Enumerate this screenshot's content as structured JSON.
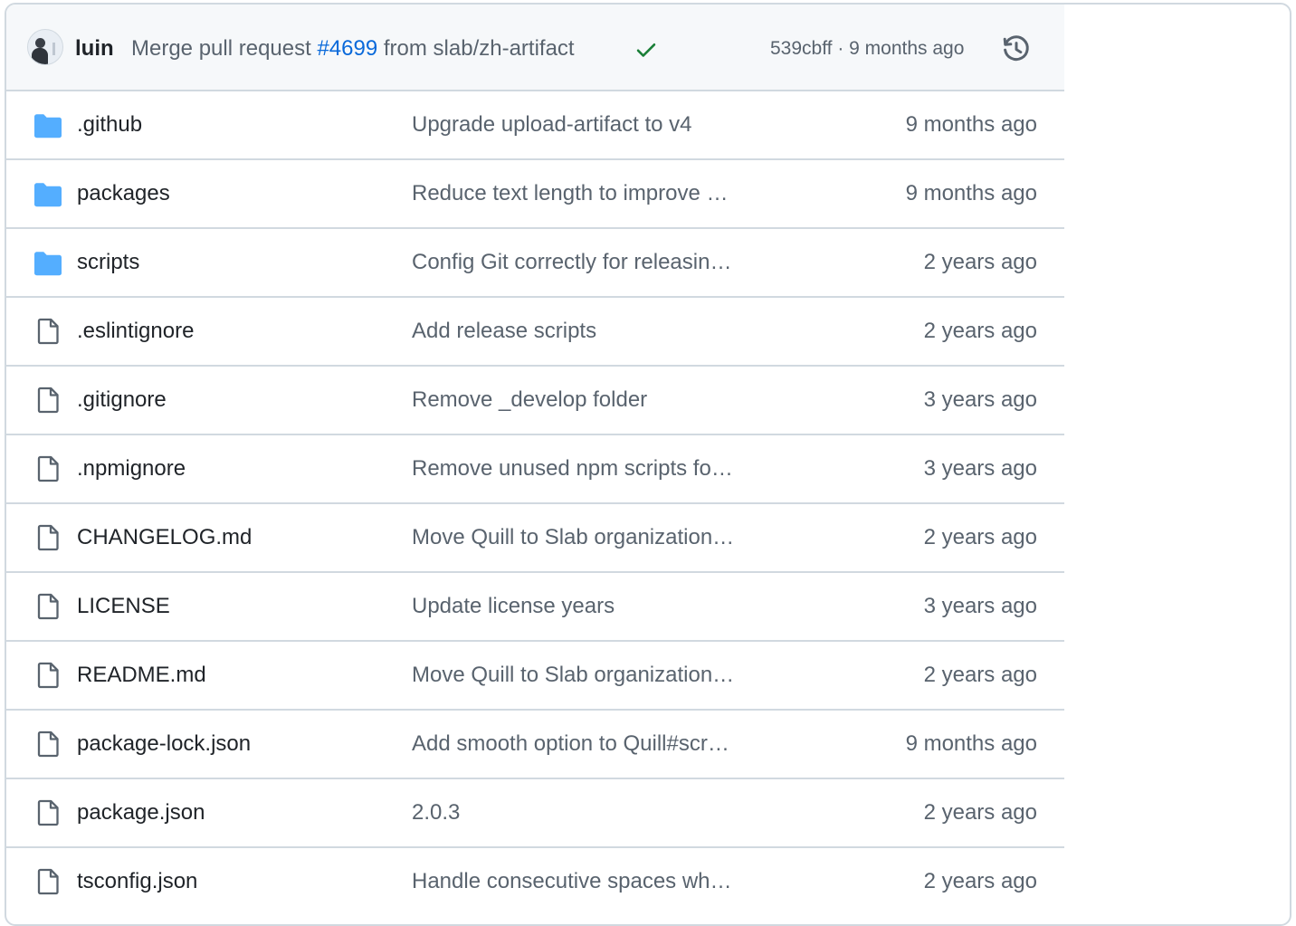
{
  "latest_commit": {
    "author": "luin",
    "message_prefix": "Merge pull request ",
    "pr_number": "#4699",
    "message_suffix": " from slab/zh-artifact",
    "status": "success",
    "sha_and_time": "539cbff · 9 months ago",
    "history_icon": "history-icon"
  },
  "colors": {
    "folder": "#54aeff",
    "link": "#0969da",
    "success": "#1a7f37",
    "muted": "#59636e"
  },
  "files": [
    {
      "type": "folder",
      "name": ".github",
      "message": "Upgrade upload-artifact to v4",
      "age": "9 months ago"
    },
    {
      "type": "folder",
      "name": "packages",
      "message": "Reduce text length to improve …",
      "age": "9 months ago"
    },
    {
      "type": "folder",
      "name": "scripts",
      "message": "Config Git correctly for releasin…",
      "age": "2 years ago"
    },
    {
      "type": "file",
      "name": ".eslintignore",
      "message": "Add release scripts",
      "age": "2 years ago"
    },
    {
      "type": "file",
      "name": ".gitignore",
      "message": "Remove _develop folder",
      "age": "3 years ago"
    },
    {
      "type": "file",
      "name": ".npmignore",
      "message": "Remove unused npm scripts fo…",
      "age": "3 years ago"
    },
    {
      "type": "file",
      "name": "CHANGELOG.md",
      "message": "Move Quill to Slab organization…",
      "age": "2 years ago"
    },
    {
      "type": "file",
      "name": "LICENSE",
      "message": "Update license years",
      "age": "3 years ago"
    },
    {
      "type": "file",
      "name": "README.md",
      "message": "Move Quill to Slab organization…",
      "age": "2 years ago"
    },
    {
      "type": "file",
      "name": "package-lock.json",
      "message": "Add smooth option to Quill#scr…",
      "age": "9 months ago"
    },
    {
      "type": "file",
      "name": "package.json",
      "message": "2.0.3",
      "age": "2 years ago"
    },
    {
      "type": "file",
      "name": "tsconfig.json",
      "message": "Handle consecutive spaces wh…",
      "age": "2 years ago"
    }
  ]
}
